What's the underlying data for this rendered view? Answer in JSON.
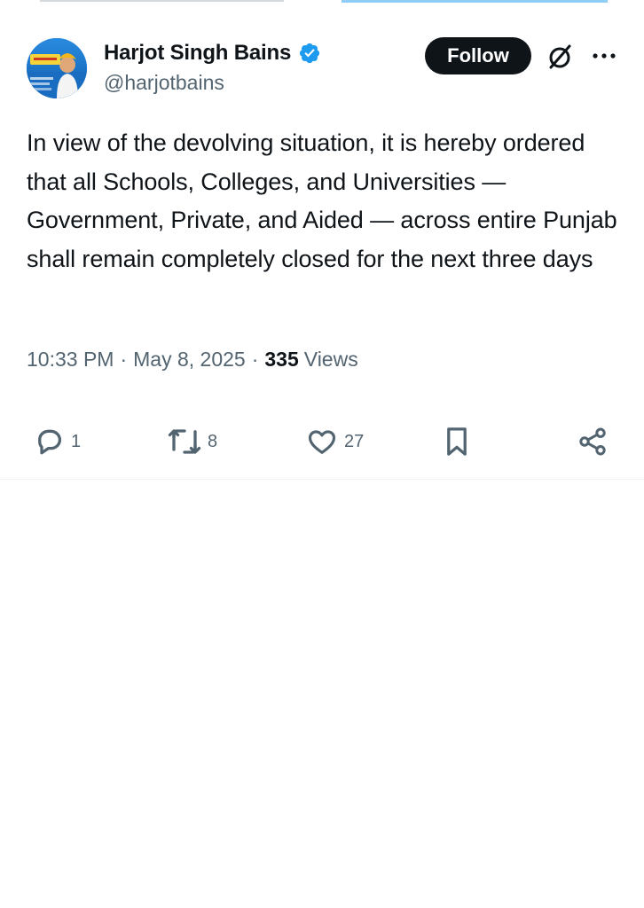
{
  "author": {
    "display_name": "Harjot Singh Bains",
    "handle": "@harjotbains",
    "avatar_banner_text": "ਪੰਜਾਬ ਸਿੱਖਿਆ ਕ੍ਰਾਂਤੀ",
    "verified_color": "#1d9bf0"
  },
  "header": {
    "follow_label": "Follow",
    "icons": [
      "grok-icon",
      "more-icon"
    ]
  },
  "tweet": {
    "text": "In view of the devolving situation, it is hereby ordered that all Schools, Colleges, and Universities — Government, Private, and Aided — across entire Punjab shall remain completely closed for the next three days",
    "time": "10:33 PM",
    "separator": "·",
    "date": "May 8, 2025",
    "views_count": "335",
    "views_label": "Views"
  },
  "actions": {
    "replies": "1",
    "reposts": "8",
    "likes": "27"
  },
  "colors": {
    "text_primary": "#0f1419",
    "text_secondary": "#536471",
    "follow_bg": "#0f1419",
    "divider": "#eff3f4"
  }
}
